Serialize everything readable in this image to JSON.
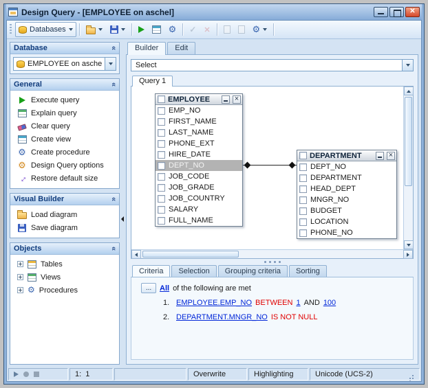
{
  "window": {
    "title": "Design Query - [EMPLOYEE on aschel]"
  },
  "toolbar": {
    "databases_label": "Databases"
  },
  "sidebar": {
    "database": {
      "header": "Database",
      "combo_value": "EMPLOYEE on aschel"
    },
    "general": {
      "header": "General",
      "items": [
        "Execute query",
        "Explain query",
        "Clear query",
        "Create view",
        "Create procedure",
        "Design Query options",
        "Restore default size"
      ]
    },
    "visual_builder": {
      "header": "Visual Builder",
      "items": [
        "Load diagram",
        "Save diagram"
      ]
    },
    "objects": {
      "header": "Objects",
      "items": [
        "Tables",
        "Views",
        "Procedures"
      ]
    }
  },
  "main": {
    "tabs": [
      "Builder",
      "Edit"
    ],
    "select_combo": "Select",
    "query_tab": "Query 1",
    "diagram": {
      "tables": [
        {
          "title": "EMPLOYEE",
          "columns": [
            "EMP_NO",
            "FIRST_NAME",
            "LAST_NAME",
            "PHONE_EXT",
            "HIRE_DATE",
            "DEPT_NO",
            "JOB_CODE",
            "JOB_GRADE",
            "JOB_COUNTRY",
            "SALARY",
            "FULL_NAME"
          ],
          "highlighted_column": "DEPT_NO"
        },
        {
          "title": "DEPARTMENT",
          "columns": [
            "DEPT_NO",
            "DEPARTMENT",
            "HEAD_DEPT",
            "MNGR_NO",
            "BUDGET",
            "LOCATION",
            "PHONE_NO"
          ]
        }
      ],
      "join": {
        "from": "EMPLOYEE.DEPT_NO",
        "to": "DEPARTMENT.DEPT_NO"
      }
    },
    "criteria_tabs": [
      "Criteria",
      "Selection",
      "Grouping criteria",
      "Sorting"
    ],
    "criteria": {
      "ellipsis_button": "...",
      "all_link": "All",
      "intro_rest": "of the following are met",
      "conditions": [
        {
          "index": "1.",
          "field": "EMPLOYEE.EMP_NO",
          "operator": "BETWEEN",
          "value1": "1",
          "conjunction": "AND",
          "value2": "100"
        },
        {
          "index": "2.",
          "field": "DEPARTMENT.MNGR_NO",
          "operator": "IS NOT NULL"
        }
      ]
    }
  },
  "statusbar": {
    "caret_position": "1:  1",
    "insert_mode": "Overwrite",
    "highlighting": "Highlighting",
    "encoding": "Unicode (UCS-2)"
  },
  "colors": {
    "titlebar_blue": "#86abd8",
    "link_blue": "#0026d8",
    "operator_red": "#e00000",
    "join_highlight_gray": "#b3b3b3"
  }
}
